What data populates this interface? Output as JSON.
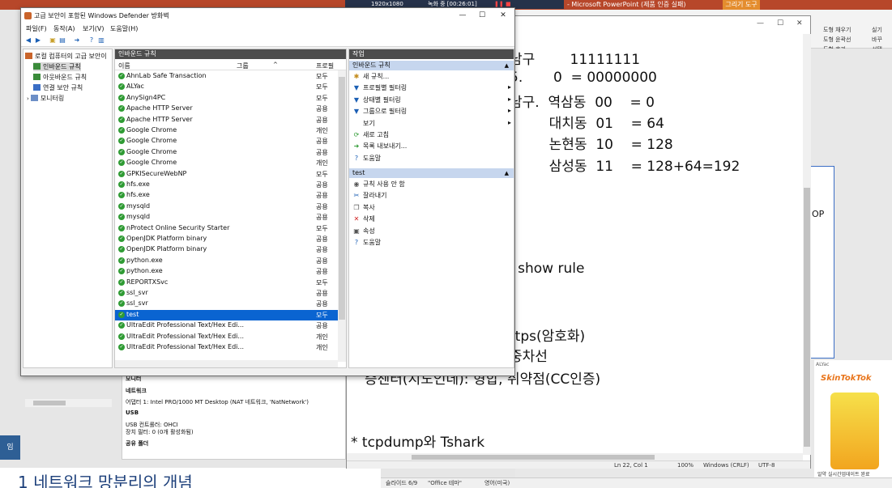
{
  "background_ppt": {
    "title": "- Microsoft PowerPoint (제품 인증 실패)",
    "context_tab": "그리기 도구",
    "ribbon_items": [
      "도형 채우기",
      "도형 윤곽선",
      "도형 효과",
      "실기",
      "바꾸",
      "선택"
    ],
    "slide_text": "OP",
    "status_items": [
      "슬라이드 6/9",
      "\"Office 테마\"",
      "영어(미국)"
    ],
    "ad_label": "ALYac",
    "ad_brand": "SkinTokTok",
    "ad_footer": "알약 실시간업데이트 완료"
  },
  "recorder": {
    "resolution": "1920x1080",
    "status": "녹화 중 [00:26:01]"
  },
  "doc_heading": "1  네트워크 망분리의 개념",
  "left_tab": "임",
  "notepad": {
    "lines": [
      "남구        11111111",
      "5.       0  = 00000000",
      "남구.  역삼동  00    = 0",
      "         대치동  01    = 64",
      "         논현동  10    = 128",
      "         삼성동  11    = 128+64=192",
      "l show rule",
      "ttps(암호화)",
      "중차선",
      "증센터(지도인데): 형합, 취약점(CC인증)",
      "* tcpdump와 Tshark"
    ],
    "status": {
      "position": "Ln 22, Col 1",
      "zoom": "100%",
      "eol": "Windows (CRLF)",
      "encoding": "UTF-8"
    }
  },
  "device_info": {
    "rows": [
      "모니터",
      "네트워크",
      "어댑터 1:  Intel PRO/1000 MT Desktop (NAT 네트워크, 'NatNetwork')",
      "USB",
      "USB 컨트롤러:  OHCI",
      "장치 필터:       0 (0개 활성화됨)",
      "공유 폴더"
    ]
  },
  "firewall": {
    "title": "고급 보안이 포함된 Windows Defender 방화벽",
    "menu": [
      "파일(F)",
      "동작(A)",
      "보기(V)",
      "도움말(H)"
    ],
    "tree": [
      {
        "label": "로컬 컴퓨터의 고급 보안이",
        "level": 0
      },
      {
        "label": "인바운드 규칙",
        "level": 1
      },
      {
        "label": "아웃바운드 규칙",
        "level": 1
      },
      {
        "label": "연결 보안 규칙",
        "level": 1
      },
      {
        "label": "모니터링",
        "level": 1
      }
    ],
    "list_title": "인바운드 규칙",
    "columns": [
      "이름",
      "그룹",
      "프로필"
    ],
    "rules": [
      {
        "name": "AhnLab Safe Transaction",
        "profile": "모두"
      },
      {
        "name": "ALYac",
        "profile": "모두"
      },
      {
        "name": "AnySign4PC",
        "profile": "모두"
      },
      {
        "name": "Apache HTTP Server",
        "profile": "공용"
      },
      {
        "name": "Apache HTTP Server",
        "profile": "공용"
      },
      {
        "name": "Google Chrome",
        "profile": "개인"
      },
      {
        "name": "Google Chrome",
        "profile": "공용"
      },
      {
        "name": "Google Chrome",
        "profile": "공용"
      },
      {
        "name": "Google Chrome",
        "profile": "개인"
      },
      {
        "name": "GPKISecureWebNP",
        "profile": "모두"
      },
      {
        "name": "hfs.exe",
        "profile": "공용"
      },
      {
        "name": "hfs.exe",
        "profile": "공용"
      },
      {
        "name": "mysqld",
        "profile": "공용"
      },
      {
        "name": "mysqld",
        "profile": "공용"
      },
      {
        "name": "nProtect Online Security Starter",
        "profile": "모두"
      },
      {
        "name": "OpenJDK Platform binary",
        "profile": "공용"
      },
      {
        "name": "OpenJDK Platform binary",
        "profile": "공용"
      },
      {
        "name": "python.exe",
        "profile": "공용"
      },
      {
        "name": "python.exe",
        "profile": "공용"
      },
      {
        "name": "REPORTXSvc",
        "profile": "모두"
      },
      {
        "name": "ssl_svr",
        "profile": "공용"
      },
      {
        "name": "ssl_svr",
        "profile": "공용"
      },
      {
        "name": "test",
        "profile": "모두",
        "selected": true
      },
      {
        "name": "UltraEdit Professional Text/Hex Edi...",
        "profile": "공용"
      },
      {
        "name": "UltraEdit Professional Text/Hex Edi...",
        "profile": "개인"
      },
      {
        "name": "UltraEdit Professional Text/Hex Edi...",
        "profile": "개인"
      }
    ],
    "actions_title": "작업",
    "section1": {
      "title": "인바운드 규칙",
      "items": [
        {
          "icon": "new-rule-icon",
          "label": "새 규칙...",
          "arrow": false
        },
        {
          "icon": "filter-icon",
          "label": "프로필별 필터링",
          "arrow": true
        },
        {
          "icon": "filter-icon",
          "label": "상태별 필터링",
          "arrow": true
        },
        {
          "icon": "filter-icon",
          "label": "그룹으로 필터링",
          "arrow": true
        },
        {
          "icon": "none",
          "label": "보기",
          "arrow": true
        },
        {
          "icon": "refresh-icon",
          "label": "새로 고침",
          "arrow": false
        },
        {
          "icon": "export-icon",
          "label": "목록 내보내기...",
          "arrow": false
        },
        {
          "icon": "help-icon",
          "label": "도움말",
          "arrow": false
        }
      ]
    },
    "section2": {
      "title": "test",
      "items": [
        {
          "icon": "disable-icon",
          "label": "규칙 사용 안 함"
        },
        {
          "icon": "cut-icon",
          "label": "잘라내기"
        },
        {
          "icon": "copy-icon",
          "label": "복사"
        },
        {
          "icon": "delete-icon",
          "label": "삭제"
        },
        {
          "icon": "properties-icon",
          "label": "속성"
        },
        {
          "icon": "help-icon",
          "label": "도움말"
        }
      ]
    },
    "colors": {
      "selection": "#0a64d1",
      "section_header": "#c6d6ee",
      "pane_header": "#4d4d4d",
      "enabled_check": "#2f9b34"
    }
  }
}
